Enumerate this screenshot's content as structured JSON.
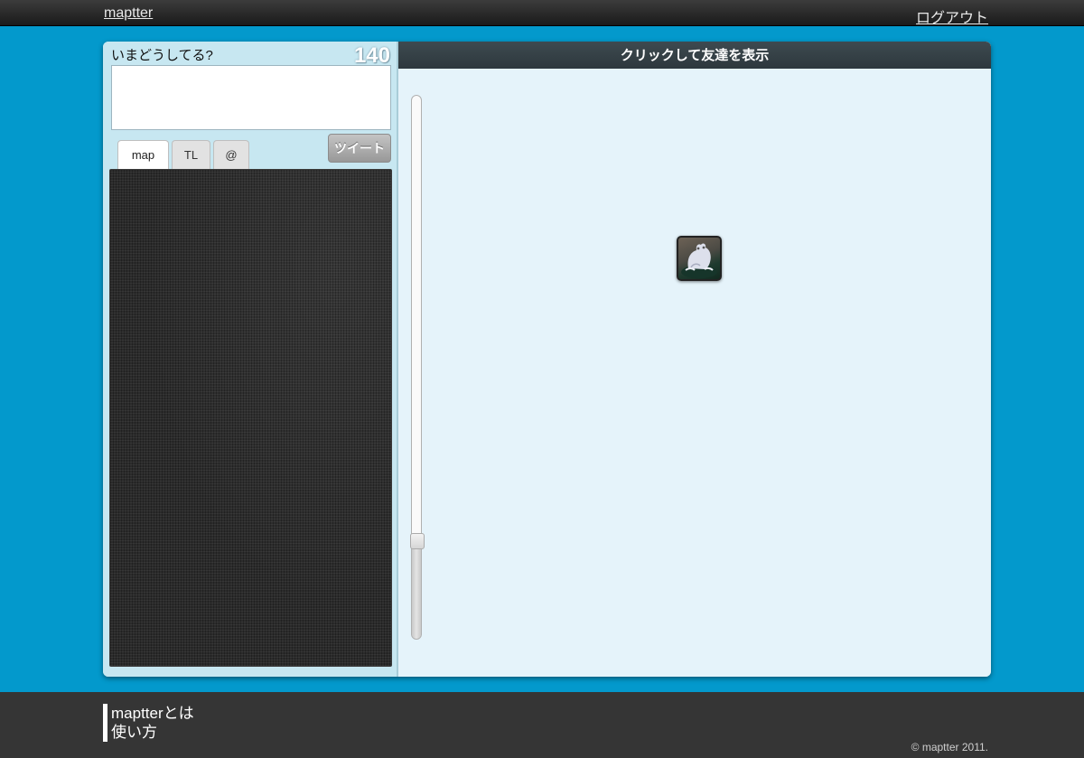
{
  "header": {
    "logo": "maptter",
    "logout": "ログアウト"
  },
  "compose": {
    "label": "いまどうしてる?",
    "char_count": "140",
    "text": "",
    "tweet_button": "ツイート"
  },
  "tabs": [
    {
      "label": "map",
      "active": true
    },
    {
      "label": "TL",
      "active": false
    },
    {
      "label": "@",
      "active": false
    }
  ],
  "friends": {
    "header": "クリックして友達を表示",
    "zoom_level_fraction": 0.17,
    "avatar_icon": "frog-avatar-icon"
  },
  "footer": {
    "links": [
      "maptterとは",
      "使い方"
    ],
    "copyright": "© maptter 2011."
  },
  "colors": {
    "background": "#0399cc",
    "right_panel": "#e5f3fa",
    "left_panel": "#c7e7f1"
  }
}
